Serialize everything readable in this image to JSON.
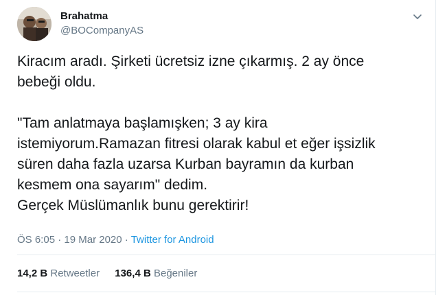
{
  "author": {
    "name": "Brahatma",
    "handle": "@BOCompanyAS"
  },
  "tweet": {
    "text": "Kiracım aradı. Şirketi ücretsiz izne çıkarmış. 2 ay önce\nbebeği oldu.\n\n\"Tam anlatmaya başlamışken; 3 ay kira\nistemiyorum.Ramazan fitresi olarak kabul et eğer işsizlik\nsüren daha fazla uzarsa Kurban bayramın da kurban\nkesmem ona sayarım\" dedim.\nGerçek Müslümanlık bunu gerektirir!",
    "time": "ÖS 6:05",
    "separator": "·",
    "date": "19 Mar 2020",
    "source": "Twitter for Android"
  },
  "stats": {
    "retweets_count": "14,2 B",
    "retweets_label": "Retweetler",
    "likes_count": "136,4 B",
    "likes_label": "Beğeniler"
  },
  "icons": {
    "caret": "chevron-down-icon",
    "avatar": "avatar"
  },
  "colors": {
    "text": "#14171a",
    "muted": "#657786",
    "link": "#1b95e0",
    "divider": "#e6ecf0"
  }
}
